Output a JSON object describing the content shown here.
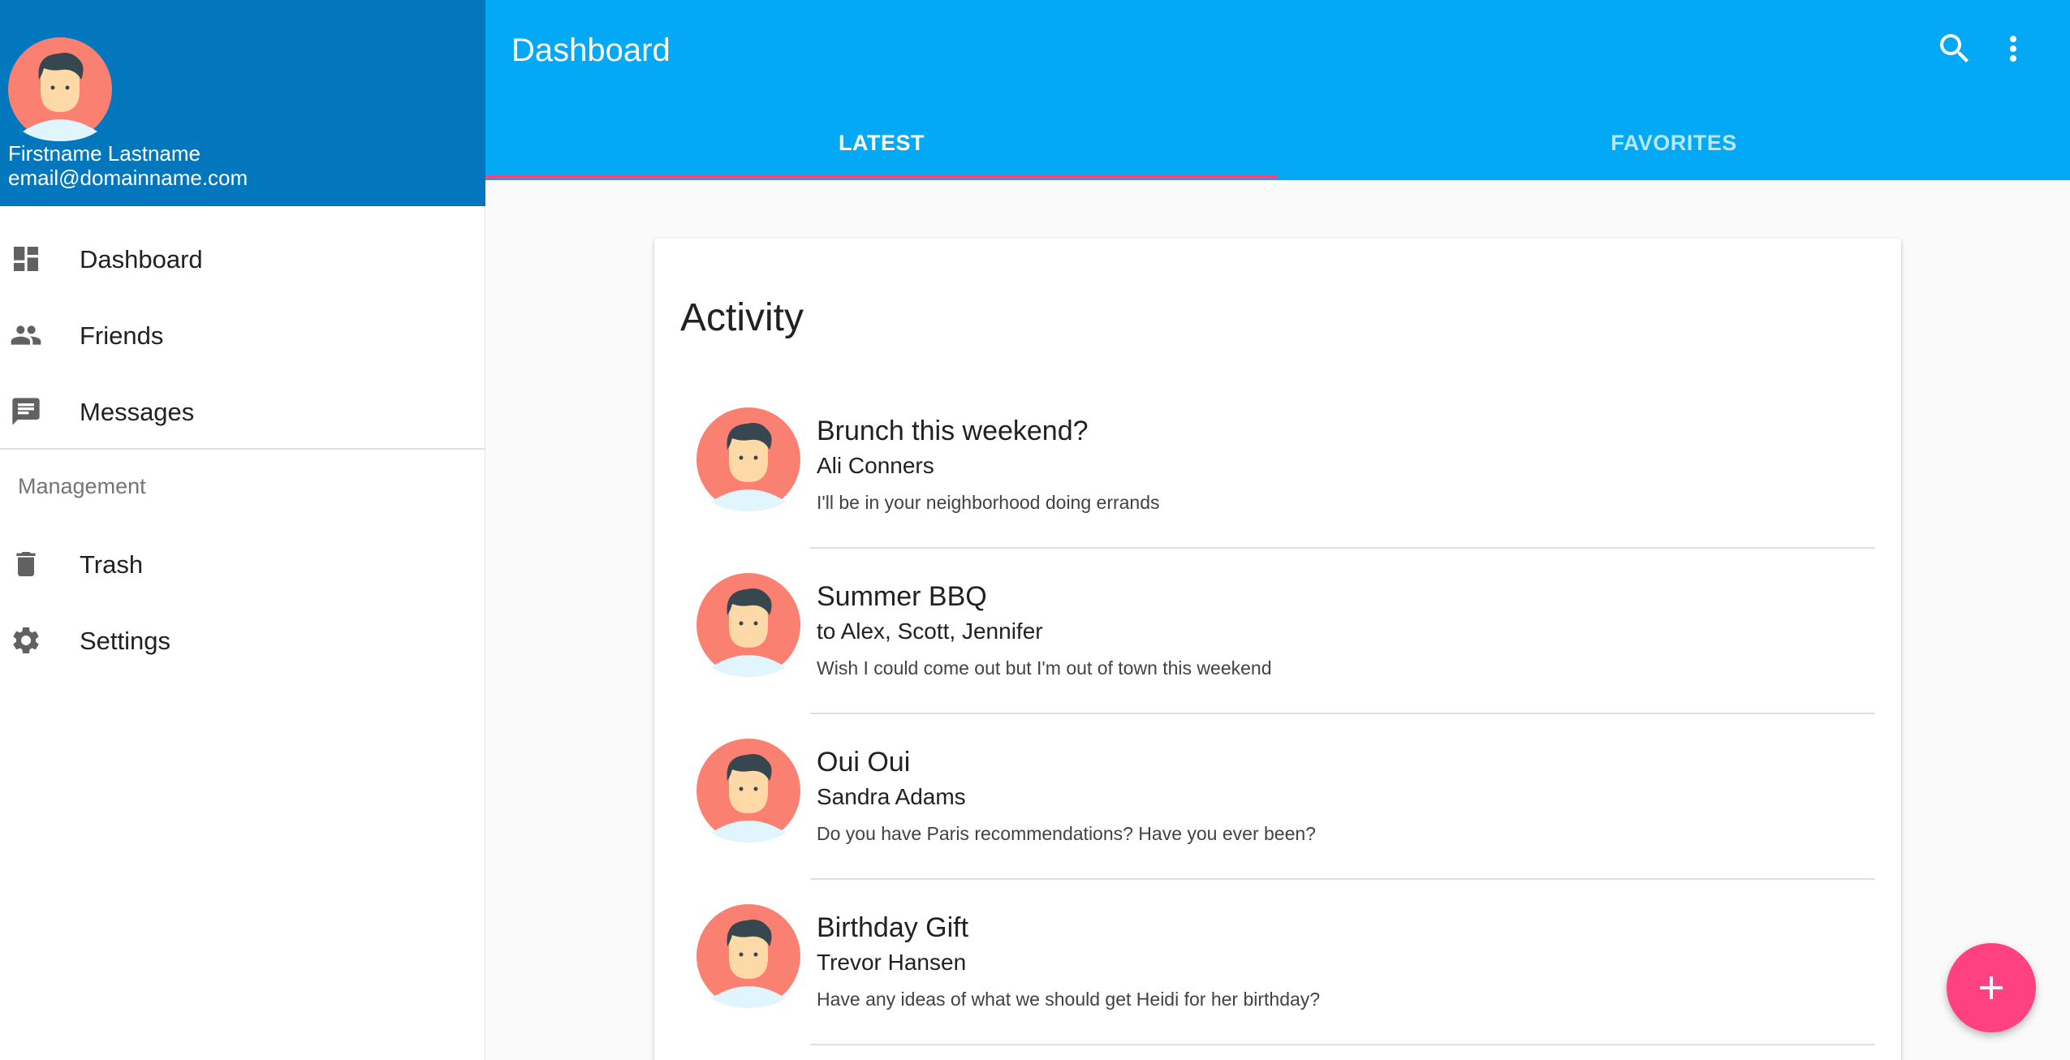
{
  "drawer": {
    "user": {
      "name": "Firstname Lastname",
      "email": "email@domainname.com",
      "avatar_icon": "person-avatar-icon"
    },
    "primary_items": [
      {
        "label": "Dashboard",
        "icon": "dashboard-icon"
      },
      {
        "label": "Friends",
        "icon": "people-icon"
      },
      {
        "label": "Messages",
        "icon": "message-icon"
      }
    ],
    "subheader": "Management",
    "secondary_items": [
      {
        "label": "Trash",
        "icon": "trash-icon"
      },
      {
        "label": "Settings",
        "icon": "gear-icon"
      }
    ]
  },
  "appbar": {
    "title": "Dashboard",
    "actions": [
      "search-icon",
      "more-vert-icon"
    ],
    "tabs": [
      {
        "label": "LATEST",
        "active": true
      },
      {
        "label": "FAVORITES",
        "active": false
      }
    ]
  },
  "activity": {
    "title": "Activity",
    "items": [
      {
        "title": "Brunch this weekend?",
        "subtitle": "Ali Conners",
        "body": "I'll be in your neighborhood doing errands"
      },
      {
        "title": "Summer BBQ",
        "subtitle": "to Alex, Scott, Jennifer",
        "body": "Wish I could come out but I'm out of town this weekend"
      },
      {
        "title": "Oui Oui",
        "subtitle": "Sandra Adams",
        "body": "Do you have Paris recommendations? Have you ever been?"
      },
      {
        "title": "Birthday Gift",
        "subtitle": "Trevor Hansen",
        "body": "Have any ideas of what we should get Heidi for her birthday?"
      }
    ]
  },
  "fab": {
    "icon": "plus-icon"
  },
  "colors": {
    "drawer_header": "#0277bd",
    "appbar": "#03a9f4",
    "accent": "#ff4081",
    "avatar_bg": "#fa8072"
  }
}
